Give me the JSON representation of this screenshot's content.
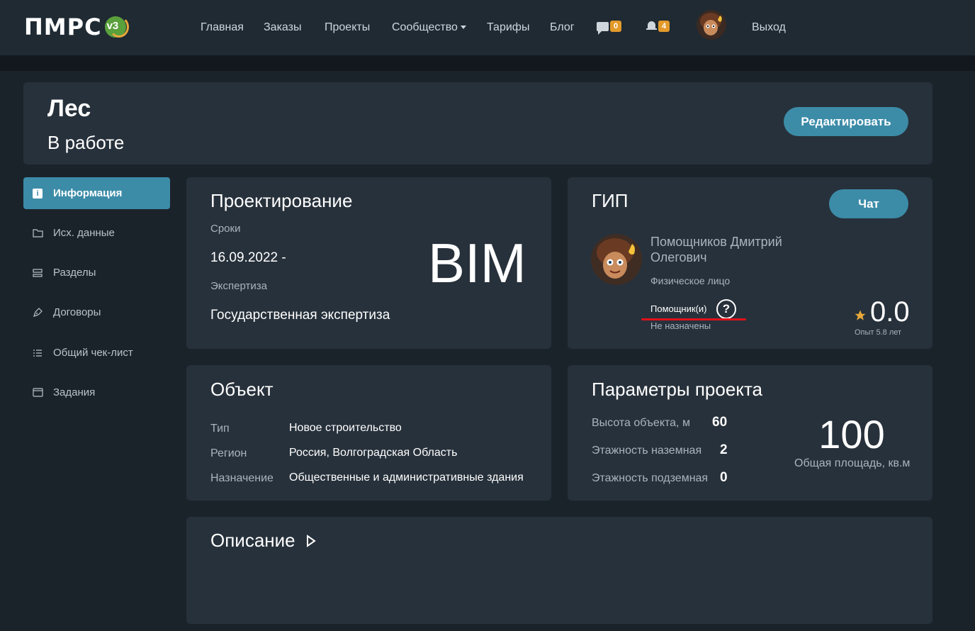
{
  "header": {
    "logo_text": "ПМРС",
    "logo_badge": "v3",
    "nav": [
      "Главная",
      "Заказы",
      "Проекты",
      "Сообщество",
      "Тарифы",
      "Блог"
    ],
    "messages_count": "0",
    "notifications_count": "4",
    "logout": "Выход"
  },
  "project": {
    "title": "Лес",
    "status": "В работе",
    "edit_button": "Редактировать"
  },
  "sidebar": {
    "items": [
      {
        "label": "Информация",
        "icon": "info-icon"
      },
      {
        "label": "Исх. данные",
        "icon": "folder-icon"
      },
      {
        "label": "Разделы",
        "icon": "sections-icon"
      },
      {
        "label": "Договоры",
        "icon": "pen-icon"
      },
      {
        "label": "Общий чек-лист",
        "icon": "checklist-icon"
      },
      {
        "label": "Задания",
        "icon": "tasks-icon"
      }
    ]
  },
  "design": {
    "heading": "Проектирование",
    "deadline_label": "Сроки",
    "deadline_value": "16.09.2022 -",
    "expertise_label": "Экспертиза",
    "expertise_value": "Государственная экспертиза",
    "bim": "BIM"
  },
  "gip": {
    "heading": "ГИП",
    "chat_button": "Чат",
    "name_line1": "Помощников Дмитрий",
    "name_line2": "Олегович",
    "person_type": "Физическое лицо",
    "assistants_label": "Помощник(и)",
    "assistants_value": "Не назначены",
    "rating": "0.0",
    "experience": "Опыт 5.8 лет",
    "colors": {
      "star": "#e8a93a",
      "underline": "#e0101a"
    }
  },
  "object": {
    "heading": "Объект",
    "rows": [
      {
        "label": "Тип",
        "value": "Новое строительство"
      },
      {
        "label": "Регион",
        "value": "Россия, Волгоградская Область"
      },
      {
        "label": "Назначение",
        "value": "Общественные и административные здания"
      }
    ]
  },
  "params": {
    "heading": "Параметры проекта",
    "rows": [
      {
        "label": "Высота объекта, м",
        "value": "60"
      },
      {
        "label": "Этажность наземная",
        "value": "2"
      },
      {
        "label": "Этажность подземная",
        "value": "0"
      }
    ],
    "area_value": "100",
    "area_label": "Общая площадь, кв.м"
  },
  "description": {
    "heading": "Описание"
  }
}
